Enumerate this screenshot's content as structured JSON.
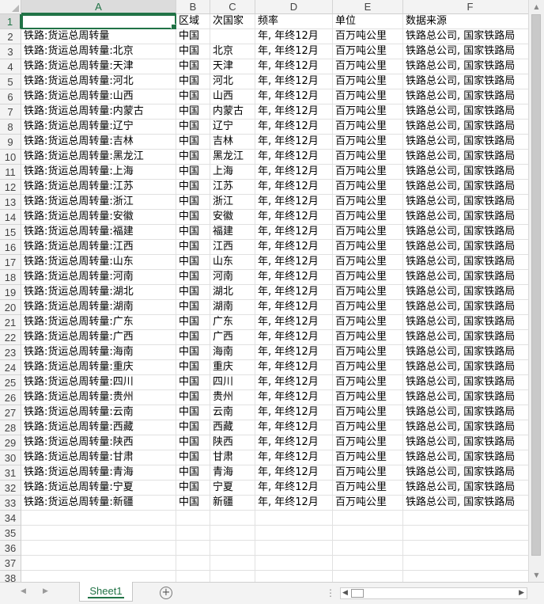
{
  "columns": [
    "A",
    "B",
    "C",
    "D",
    "E",
    "F"
  ],
  "selected_column": "A",
  "selected_row": "1",
  "header_row": {
    "a": "",
    "b": "区域",
    "c": "次国家",
    "d": "频率",
    "e": "单位",
    "f": "数据来源"
  },
  "rows": [
    {
      "n": "2",
      "a": "铁路:货运总周转量",
      "b": "中国",
      "c": "",
      "d": "年, 年终12月",
      "e": "百万吨公里",
      "f": "铁路总公司, 国家铁路局"
    },
    {
      "n": "3",
      "a": "铁路:货运总周转量:北京",
      "b": "中国",
      "c": "北京",
      "d": "年, 年终12月",
      "e": "百万吨公里",
      "f": "铁路总公司, 国家铁路局"
    },
    {
      "n": "4",
      "a": "铁路:货运总周转量:天津",
      "b": "中国",
      "c": "天津",
      "d": "年, 年终12月",
      "e": "百万吨公里",
      "f": "铁路总公司, 国家铁路局"
    },
    {
      "n": "5",
      "a": "铁路:货运总周转量:河北",
      "b": "中国",
      "c": "河北",
      "d": "年, 年终12月",
      "e": "百万吨公里",
      "f": "铁路总公司, 国家铁路局"
    },
    {
      "n": "6",
      "a": "铁路:货运总周转量:山西",
      "b": "中国",
      "c": "山西",
      "d": "年, 年终12月",
      "e": "百万吨公里",
      "f": "铁路总公司, 国家铁路局"
    },
    {
      "n": "7",
      "a": "铁路:货运总周转量:内蒙古",
      "b": "中国",
      "c": "内蒙古",
      "d": "年, 年终12月",
      "e": "百万吨公里",
      "f": "铁路总公司, 国家铁路局"
    },
    {
      "n": "8",
      "a": "铁路:货运总周转量:辽宁",
      "b": "中国",
      "c": "辽宁",
      "d": "年, 年终12月",
      "e": "百万吨公里",
      "f": "铁路总公司, 国家铁路局"
    },
    {
      "n": "9",
      "a": "铁路:货运总周转量:吉林",
      "b": "中国",
      "c": "吉林",
      "d": "年, 年终12月",
      "e": "百万吨公里",
      "f": "铁路总公司, 国家铁路局"
    },
    {
      "n": "10",
      "a": "铁路:货运总周转量:黑龙江",
      "b": "中国",
      "c": "黑龙江",
      "d": "年, 年终12月",
      "e": "百万吨公里",
      "f": "铁路总公司, 国家铁路局"
    },
    {
      "n": "11",
      "a": "铁路:货运总周转量:上海",
      "b": "中国",
      "c": "上海",
      "d": "年, 年终12月",
      "e": "百万吨公里",
      "f": "铁路总公司, 国家铁路局"
    },
    {
      "n": "12",
      "a": "铁路:货运总周转量:江苏",
      "b": "中国",
      "c": "江苏",
      "d": "年, 年终12月",
      "e": "百万吨公里",
      "f": "铁路总公司, 国家铁路局"
    },
    {
      "n": "13",
      "a": "铁路:货运总周转量:浙江",
      "b": "中国",
      "c": "浙江",
      "d": "年, 年终12月",
      "e": "百万吨公里",
      "f": "铁路总公司, 国家铁路局"
    },
    {
      "n": "14",
      "a": "铁路:货运总周转量:安徽",
      "b": "中国",
      "c": "安徽",
      "d": "年, 年终12月",
      "e": "百万吨公里",
      "f": "铁路总公司, 国家铁路局"
    },
    {
      "n": "15",
      "a": "铁路:货运总周转量:福建",
      "b": "中国",
      "c": "福建",
      "d": "年, 年终12月",
      "e": "百万吨公里",
      "f": "铁路总公司, 国家铁路局"
    },
    {
      "n": "16",
      "a": "铁路:货运总周转量:江西",
      "b": "中国",
      "c": "江西",
      "d": "年, 年终12月",
      "e": "百万吨公里",
      "f": "铁路总公司, 国家铁路局"
    },
    {
      "n": "17",
      "a": "铁路:货运总周转量:山东",
      "b": "中国",
      "c": "山东",
      "d": "年, 年终12月",
      "e": "百万吨公里",
      "f": "铁路总公司, 国家铁路局"
    },
    {
      "n": "18",
      "a": "铁路:货运总周转量:河南",
      "b": "中国",
      "c": "河南",
      "d": "年, 年终12月",
      "e": "百万吨公里",
      "f": "铁路总公司, 国家铁路局"
    },
    {
      "n": "19",
      "a": "铁路:货运总周转量:湖北",
      "b": "中国",
      "c": "湖北",
      "d": "年, 年终12月",
      "e": "百万吨公里",
      "f": "铁路总公司, 国家铁路局"
    },
    {
      "n": "20",
      "a": "铁路:货运总周转量:湖南",
      "b": "中国",
      "c": "湖南",
      "d": "年, 年终12月",
      "e": "百万吨公里",
      "f": "铁路总公司, 国家铁路局"
    },
    {
      "n": "21",
      "a": "铁路:货运总周转量:广东",
      "b": "中国",
      "c": "广东",
      "d": "年, 年终12月",
      "e": "百万吨公里",
      "f": "铁路总公司, 国家铁路局"
    },
    {
      "n": "22",
      "a": "铁路:货运总周转量:广西",
      "b": "中国",
      "c": "广西",
      "d": "年, 年终12月",
      "e": "百万吨公里",
      "f": "铁路总公司, 国家铁路局"
    },
    {
      "n": "23",
      "a": "铁路:货运总周转量:海南",
      "b": "中国",
      "c": "海南",
      "d": "年, 年终12月",
      "e": "百万吨公里",
      "f": "铁路总公司, 国家铁路局"
    },
    {
      "n": "24",
      "a": "铁路:货运总周转量:重庆",
      "b": "中国",
      "c": "重庆",
      "d": "年, 年终12月",
      "e": "百万吨公里",
      "f": "铁路总公司, 国家铁路局"
    },
    {
      "n": "25",
      "a": "铁路:货运总周转量:四川",
      "b": "中国",
      "c": "四川",
      "d": "年, 年终12月",
      "e": "百万吨公里",
      "f": "铁路总公司, 国家铁路局"
    },
    {
      "n": "26",
      "a": "铁路:货运总周转量:贵州",
      "b": "中国",
      "c": "贵州",
      "d": "年, 年终12月",
      "e": "百万吨公里",
      "f": "铁路总公司, 国家铁路局"
    },
    {
      "n": "27",
      "a": "铁路:货运总周转量:云南",
      "b": "中国",
      "c": "云南",
      "d": "年, 年终12月",
      "e": "百万吨公里",
      "f": "铁路总公司, 国家铁路局"
    },
    {
      "n": "28",
      "a": "铁路:货运总周转量:西藏",
      "b": "中国",
      "c": "西藏",
      "d": "年, 年终12月",
      "e": "百万吨公里",
      "f": "铁路总公司, 国家铁路局"
    },
    {
      "n": "29",
      "a": "铁路:货运总周转量:陕西",
      "b": "中国",
      "c": "陕西",
      "d": "年, 年终12月",
      "e": "百万吨公里",
      "f": "铁路总公司, 国家铁路局"
    },
    {
      "n": "30",
      "a": "铁路:货运总周转量:甘肃",
      "b": "中国",
      "c": "甘肃",
      "d": "年, 年终12月",
      "e": "百万吨公里",
      "f": "铁路总公司, 国家铁路局"
    },
    {
      "n": "31",
      "a": "铁路:货运总周转量:青海",
      "b": "中国",
      "c": "青海",
      "d": "年, 年终12月",
      "e": "百万吨公里",
      "f": "铁路总公司, 国家铁路局"
    },
    {
      "n": "32",
      "a": "铁路:货运总周转量:宁夏",
      "b": "中国",
      "c": "宁夏",
      "d": "年, 年终12月",
      "e": "百万吨公里",
      "f": "铁路总公司, 国家铁路局"
    },
    {
      "n": "33",
      "a": "铁路:货运总周转量:新疆",
      "b": "中国",
      "c": "新疆",
      "d": "年, 年终12月",
      "e": "百万吨公里",
      "f": "铁路总公司, 国家铁路局"
    }
  ],
  "empty_rows": [
    "34",
    "35",
    "36",
    "37",
    "38"
  ],
  "sheet_tab": {
    "label": "Sheet1"
  },
  "icons": {
    "add_sheet": "plus-circle-icon",
    "nav_prev": "triangle-left-icon",
    "nav_next": "triangle-right-icon"
  },
  "colors": {
    "accent": "#217346",
    "header_bg": "#f3f3f3",
    "gridline": "#e1e1e1"
  }
}
